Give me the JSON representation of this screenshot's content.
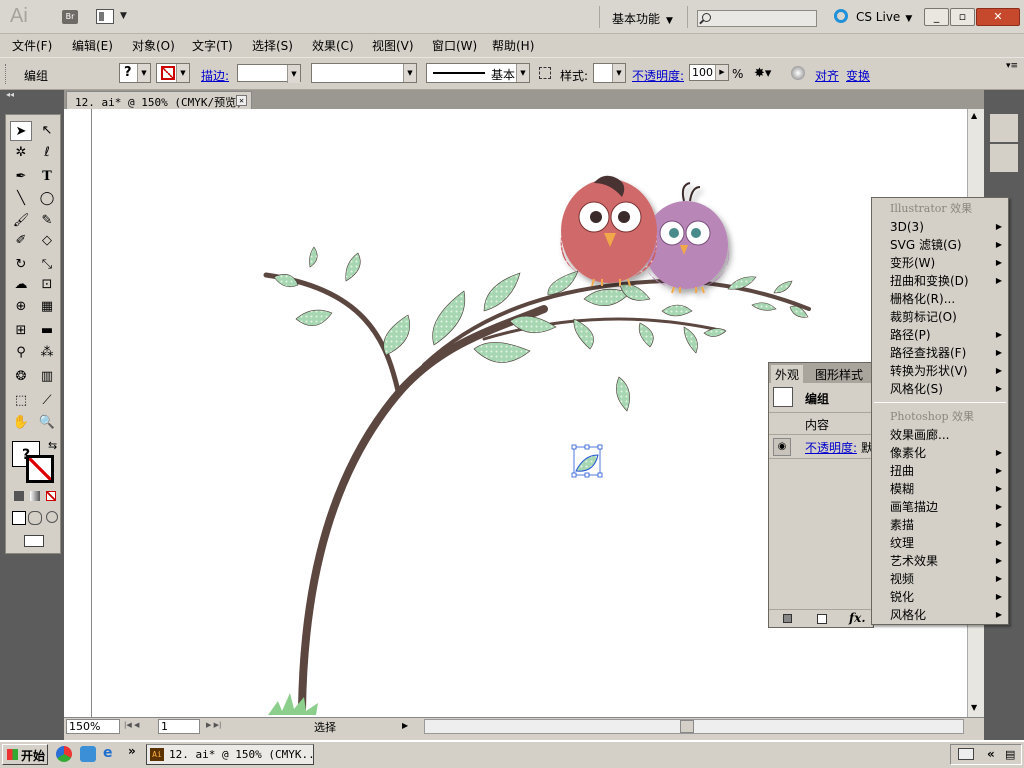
{
  "app": {
    "logo": "Ai",
    "bridge_label": "Br",
    "workspace": "基本功能",
    "cs_live": "CS Live",
    "minimize": "_",
    "restore": "▫",
    "close": "✕"
  },
  "menu": [
    "文件(F)",
    "编辑(E)",
    "对象(O)",
    "文字(T)",
    "选择(S)",
    "效果(C)",
    "视图(V)",
    "窗口(W)",
    "帮助(H)"
  ],
  "control": {
    "label": "编组",
    "stroke_label": "描边:",
    "brush_label": "基本",
    "style_label": "样式:",
    "opacity_label": "不透明度:",
    "opacity_value": "100",
    "opacity_unit": "%",
    "align_label": "对齐",
    "transform_label": "变换",
    "fill_glyph": "?"
  },
  "document": {
    "tab_title": "12. ai* @ 150% (CMYK/预览)",
    "close_glyph": "✕"
  },
  "status": {
    "zoom": "150%",
    "page": "1",
    "tool": "选择"
  },
  "toolbox": {
    "type_tool": "T",
    "help_glyph": "?"
  },
  "appearance": {
    "tab_appearance": "外观",
    "tab_graphic_styles": "图形样式",
    "group_label": "编组",
    "contents_label": "内容",
    "opacity_label": "不透明度:",
    "opacity_trunc": "默",
    "fx": "fx."
  },
  "effect_menu": {
    "illustrator_header": "Illustrator 效果",
    "illustrator_items": [
      {
        "label": "3D(3)",
        "submenu": true
      },
      {
        "label": "SVG 滤镜(G)",
        "submenu": true
      },
      {
        "label": "变形(W)",
        "submenu": true
      },
      {
        "label": "扭曲和变换(D)",
        "submenu": true
      },
      {
        "label": "栅格化(R)...",
        "submenu": false
      },
      {
        "label": "裁剪标记(O)",
        "submenu": false
      },
      {
        "label": "路径(P)",
        "submenu": true
      },
      {
        "label": "路径查找器(F)",
        "submenu": true
      },
      {
        "label": "转换为形状(V)",
        "submenu": true
      },
      {
        "label": "风格化(S)",
        "submenu": true
      }
    ],
    "photoshop_header": "Photoshop 效果",
    "photoshop_items": [
      {
        "label": "效果画廊...",
        "submenu": false
      },
      {
        "label": "像素化",
        "submenu": true
      },
      {
        "label": "扭曲",
        "submenu": true
      },
      {
        "label": "模糊",
        "submenu": true
      },
      {
        "label": "画笔描边",
        "submenu": true
      },
      {
        "label": "素描",
        "submenu": true
      },
      {
        "label": "纹理",
        "submenu": true
      },
      {
        "label": "艺术效果",
        "submenu": true
      },
      {
        "label": "视频",
        "submenu": true
      },
      {
        "label": "锐化",
        "submenu": true
      },
      {
        "label": "风格化",
        "submenu": true
      }
    ]
  },
  "taskbar": {
    "start": "开始",
    "task_title": "12. ai* @ 150% (CMYK...",
    "chevron": "»",
    "tray_chevron": "«"
  },
  "colors": {
    "branch": "#5b4640",
    "leaf": "#a7d7b2",
    "bird_red": "#d06a6a",
    "bird_purple": "#b887b8",
    "beak": "#f0a848"
  }
}
